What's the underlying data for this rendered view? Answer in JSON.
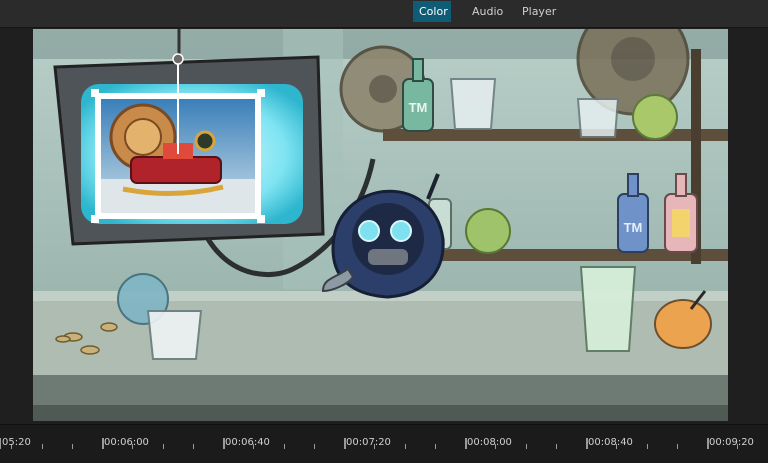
{
  "tabs": [
    {
      "label": "Color",
      "active": true
    },
    {
      "label": "Audio",
      "active": false
    },
    {
      "label": "Player",
      "active": false
    }
  ],
  "viewer": {
    "bottle_labels": [
      "TM",
      "TM"
    ]
  },
  "timeline": {
    "labels": [
      "05:20",
      "00:06:00",
      "00:06:40",
      "00:07:20",
      "00:08:00",
      "00:08:40",
      "00:09:20"
    ]
  },
  "colors": {
    "accent": "#0f5c77",
    "background": "#1f1f1f"
  }
}
